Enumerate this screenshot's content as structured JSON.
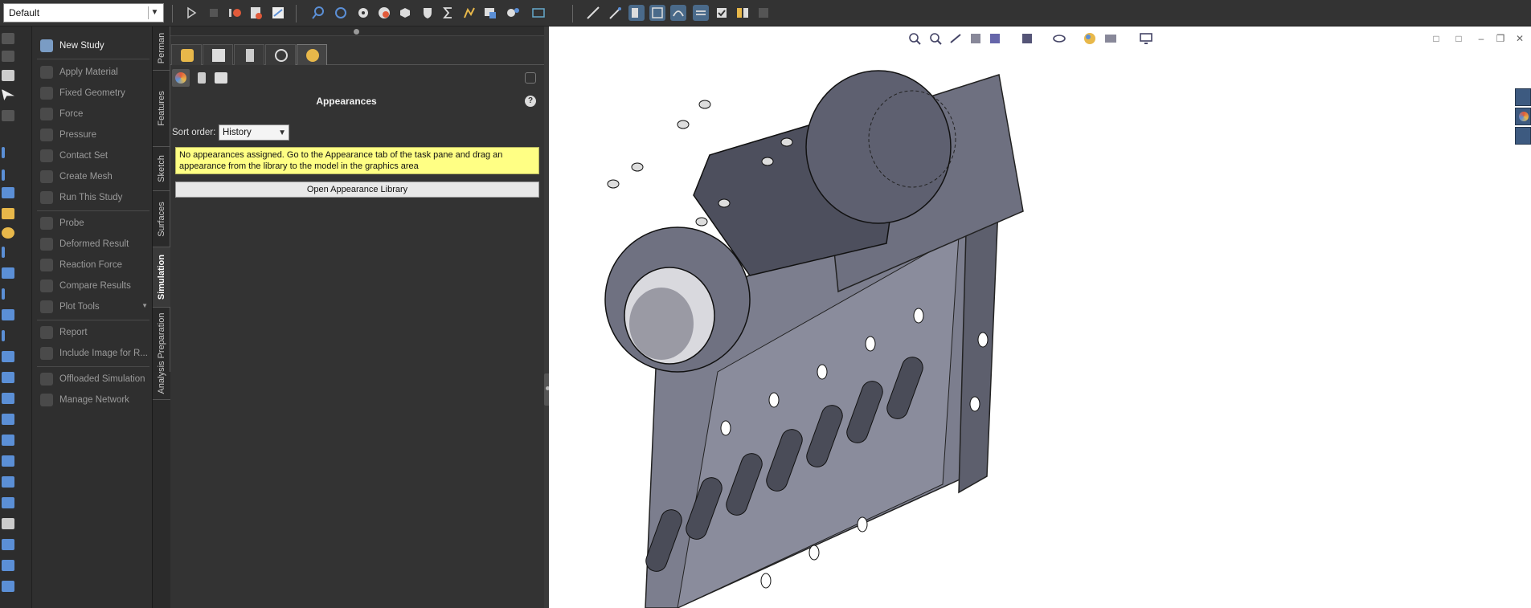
{
  "toolbar": {
    "configuration": "Default",
    "colors": {
      "accent": "#4a6a8a",
      "icon_blue": "#5b8fd6",
      "icon_yellow": "#e8b84a"
    }
  },
  "sim_menu": {
    "items": [
      {
        "label": "New Study",
        "enabled": true,
        "icon": "new-study-icon"
      },
      {
        "label": "Apply Material",
        "enabled": false,
        "icon": "material-icon"
      },
      {
        "label": "Fixed Geometry",
        "enabled": false,
        "icon": "fixture-icon"
      },
      {
        "label": "Force",
        "enabled": false,
        "icon": "force-icon"
      },
      {
        "label": "Pressure",
        "enabled": false,
        "icon": "pressure-icon"
      },
      {
        "label": "Contact Set",
        "enabled": false,
        "icon": "contact-icon"
      },
      {
        "label": "Create Mesh",
        "enabled": false,
        "icon": "mesh-icon"
      },
      {
        "label": "Run This Study",
        "enabled": false,
        "icon": "run-icon"
      },
      {
        "label": "Probe",
        "enabled": false,
        "icon": "probe-icon"
      },
      {
        "label": "Deformed Result",
        "enabled": false,
        "icon": "deformed-icon"
      },
      {
        "label": "Reaction Force",
        "enabled": false,
        "icon": "reaction-icon"
      },
      {
        "label": "Compare Results",
        "enabled": false,
        "icon": "compare-icon"
      },
      {
        "label": "Plot Tools",
        "enabled": false,
        "icon": "plot-icon"
      },
      {
        "label": "Report",
        "enabled": false,
        "icon": "report-icon"
      },
      {
        "label": "Include Image for R...",
        "enabled": false,
        "icon": "image-icon"
      },
      {
        "label": "Offloaded Simulation",
        "enabled": false,
        "icon": "offload-icon"
      },
      {
        "label": "Manage Network",
        "enabled": false,
        "icon": "network-icon"
      }
    ]
  },
  "vertical_tabs": [
    "Perman",
    "Features",
    "Sketch",
    "Surfaces",
    "Simulation",
    "Analysis Preparation"
  ],
  "active_vertical_tab": "Simulation",
  "task_pane": {
    "title": "Appearances",
    "help": "?",
    "sort_label": "Sort order:",
    "sort_value": "History",
    "notice": "No appearances assigned. Go to the Appearance tab of the task pane and drag an appearance from the library to the model in the graphics area",
    "open_library": "Open Appearance Library"
  }
}
